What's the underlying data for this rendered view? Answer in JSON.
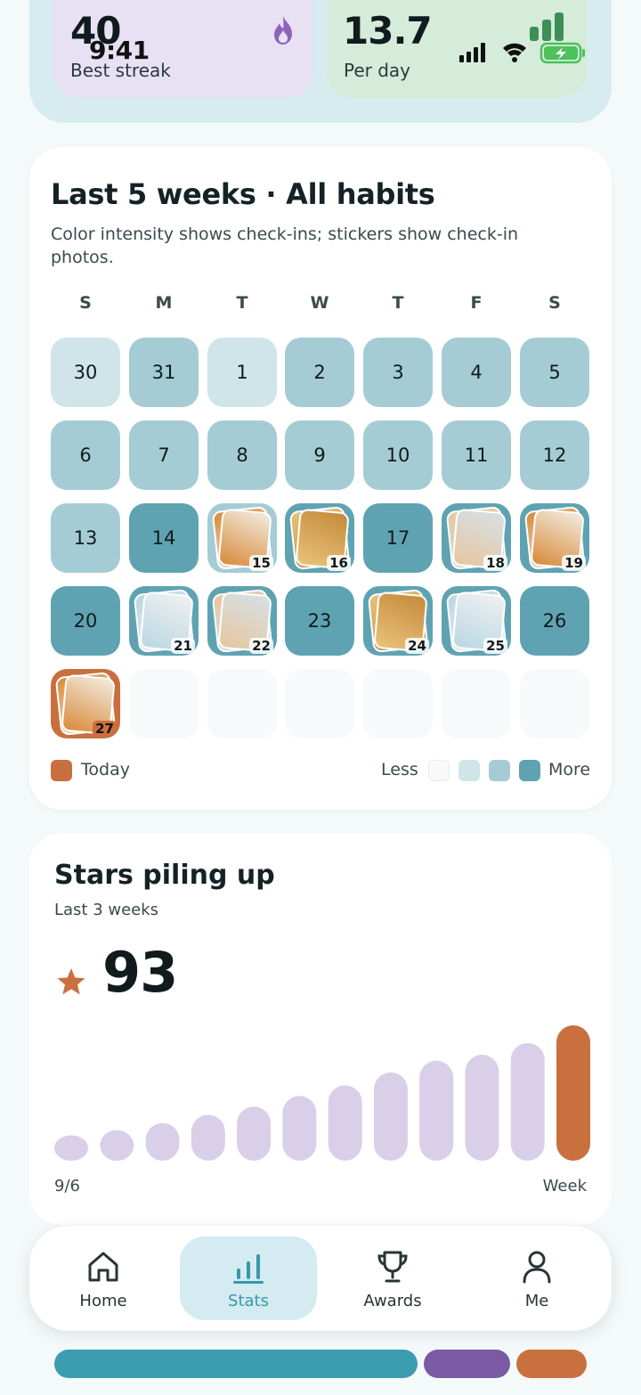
{
  "status_bar": {
    "time": "9:41"
  },
  "top_stats": {
    "best_streak": {
      "value": "40",
      "label": "Best streak",
      "icon": "flame-icon"
    },
    "per_day": {
      "value": "13.7",
      "label": "Per day",
      "icon": "bar-chart-icon"
    }
  },
  "calendar": {
    "title": "Last 5 weeks · All habits",
    "subtitle": "Color intensity shows check-ins; stickers show check-in photos.",
    "weekdays": [
      "S",
      "M",
      "T",
      "W",
      "T",
      "F",
      "S"
    ],
    "days": [
      {
        "label": "30",
        "level": 1
      },
      {
        "label": "31",
        "level": 2
      },
      {
        "label": "1",
        "level": 1
      },
      {
        "label": "2",
        "level": 2
      },
      {
        "label": "3",
        "level": 2
      },
      {
        "label": "4",
        "level": 2
      },
      {
        "label": "5",
        "level": 2
      },
      {
        "label": "6",
        "level": 2
      },
      {
        "label": "7",
        "level": 2
      },
      {
        "label": "8",
        "level": 2
      },
      {
        "label": "9",
        "level": 2
      },
      {
        "label": "10",
        "level": 2
      },
      {
        "label": "11",
        "level": 2
      },
      {
        "label": "12",
        "level": 2
      },
      {
        "label": "13",
        "level": 2
      },
      {
        "label": "14",
        "level": 3
      },
      {
        "label": "15",
        "level": 2,
        "photo": true
      },
      {
        "label": "16",
        "level": 3,
        "photo": true
      },
      {
        "label": "17",
        "level": 3
      },
      {
        "label": "18",
        "level": 3,
        "photo": true
      },
      {
        "label": "19",
        "level": 3,
        "photo": true
      },
      {
        "label": "20",
        "level": 3
      },
      {
        "label": "21",
        "level": 3,
        "photo": true
      },
      {
        "label": "22",
        "level": 3,
        "photo": true
      },
      {
        "label": "23",
        "level": 3
      },
      {
        "label": "24",
        "level": 3,
        "photo": true
      },
      {
        "label": "25",
        "level": 3,
        "photo": true
      },
      {
        "label": "26",
        "level": 3
      },
      {
        "label": "27",
        "level": 3,
        "photo": true,
        "today": true
      },
      {
        "label": "",
        "level": 0
      },
      {
        "label": "",
        "level": 0
      },
      {
        "label": "",
        "level": 0
      },
      {
        "label": "",
        "level": 0
      },
      {
        "label": "",
        "level": 0
      },
      {
        "label": "",
        "level": 0
      }
    ],
    "legend": {
      "today": "Today",
      "less": "Less",
      "more": "More"
    },
    "colors": {
      "level0": "#f7f9fa",
      "level1": "#cfe5ea",
      "level2": "#a5ccd5",
      "level3": "#5fa3b3",
      "today": "#c96f3f"
    }
  },
  "stars": {
    "title": "Stars piling up",
    "subtitle": "Last 3 weeks",
    "total": "93",
    "x_start_label": "9/6",
    "x_end_label": "Week"
  },
  "chart_data": {
    "type": "bar",
    "values": [
      1.0,
      1.3,
      1.6,
      1.95,
      2.3,
      2.75,
      3.2,
      3.75,
      4.25,
      4.5,
      5.0,
      5.75
    ],
    "highlight_last": true,
    "colors": {
      "bar": "#dacfe8",
      "highlight": "#c8713f"
    }
  },
  "nav": {
    "items": [
      {
        "label": "Home",
        "icon": "home-icon",
        "active": false
      },
      {
        "label": "Stats",
        "icon": "stats-icon",
        "active": true
      },
      {
        "label": "Awards",
        "icon": "trophy-icon",
        "active": false
      },
      {
        "label": "Me",
        "icon": "person-icon",
        "active": false
      }
    ]
  },
  "bottom_strip_colors": [
    "#3c9db0",
    "#7b5aa3",
    "#c8713f"
  ]
}
